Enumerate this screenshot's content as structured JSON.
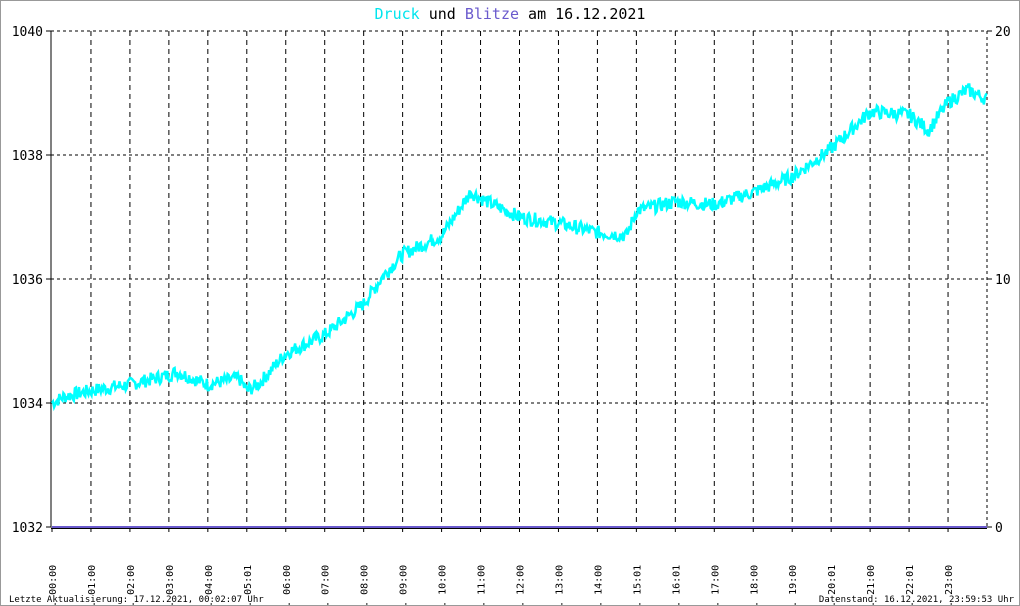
{
  "chart_data": {
    "type": "line",
    "title": {
      "part1": "Druck",
      "part2": " und ",
      "part3": "Blitze",
      "part4": " am 16.12.2021"
    },
    "colors": {
      "druck": "#00ffff",
      "blitze": "#6a5acd",
      "grid": "#000000"
    },
    "y_left": {
      "range": [
        1032,
        1040
      ],
      "ticks": [
        "1032",
        "1034",
        "1036",
        "1038",
        "1040"
      ]
    },
    "y_right": {
      "range": [
        0,
        20
      ],
      "ticks": [
        "0",
        "10",
        "20"
      ]
    },
    "x_range_hours": [
      0,
      24
    ],
    "x_ticks": [
      {
        "h": 0,
        "label": "16. 00:00"
      },
      {
        "h": 1,
        "label": "16. 01:00"
      },
      {
        "h": 2,
        "label": "16. 02:00"
      },
      {
        "h": 3,
        "label": "16. 03:00"
      },
      {
        "h": 4,
        "label": "16. 04:00"
      },
      {
        "h": 5,
        "label": "16. 05:01"
      },
      {
        "h": 6,
        "label": "16. 06:00"
      },
      {
        "h": 7,
        "label": "16. 07:00"
      },
      {
        "h": 8,
        "label": "16. 08:00"
      },
      {
        "h": 9,
        "label": "16. 09:00"
      },
      {
        "h": 10,
        "label": "16. 10:00"
      },
      {
        "h": 11,
        "label": "16. 11:00"
      },
      {
        "h": 12,
        "label": "16. 12:00"
      },
      {
        "h": 13,
        "label": "16. 13:00"
      },
      {
        "h": 14,
        "label": "16. 14:00"
      },
      {
        "h": 15,
        "label": "16. 15:01"
      },
      {
        "h": 16,
        "label": "16. 16:01"
      },
      {
        "h": 17,
        "label": "16. 17:00"
      },
      {
        "h": 18,
        "label": "16. 18:00"
      },
      {
        "h": 19,
        "label": "16. 19:00"
      },
      {
        "h": 20,
        "label": "16. 20:01"
      },
      {
        "h": 21,
        "label": "16. 21:00"
      },
      {
        "h": 22,
        "label": "16. 22:01"
      },
      {
        "h": 23,
        "label": "16. 23:00"
      }
    ],
    "series": [
      {
        "name": "Druck",
        "x": [
          0,
          0.3,
          1,
          2,
          3,
          3.2,
          4,
          4.8,
          5,
          5.3,
          6,
          7,
          8,
          8.5,
          9,
          10,
          10.75,
          11,
          12,
          13,
          14,
          14.75,
          15,
          16,
          17,
          18,
          19,
          20,
          21,
          22,
          22.5,
          23,
          23.5,
          24
        ],
        "values": [
          1034.0,
          1034.1,
          1034.2,
          1034.3,
          1034.45,
          1034.5,
          1034.3,
          1034.4,
          1034.2,
          1034.3,
          1034.8,
          1035.1,
          1035.6,
          1036.05,
          1036.4,
          1036.7,
          1037.4,
          1037.3,
          1037.0,
          1036.9,
          1036.75,
          1036.7,
          1037.1,
          1037.25,
          1037.2,
          1037.4,
          1037.65,
          1038.1,
          1038.7,
          1038.65,
          1038.4,
          1038.85,
          1039.05,
          1038.9
        ]
      },
      {
        "name": "Blitze",
        "x": [
          0,
          24
        ],
        "values": [
          0,
          0
        ]
      }
    ]
  },
  "footer": {
    "left": "Letzte Aktualisierung: 17.12.2021, 00:02:07 Uhr",
    "right": "Datenstand: 16.12.2021, 23:59:53 Uhr"
  }
}
